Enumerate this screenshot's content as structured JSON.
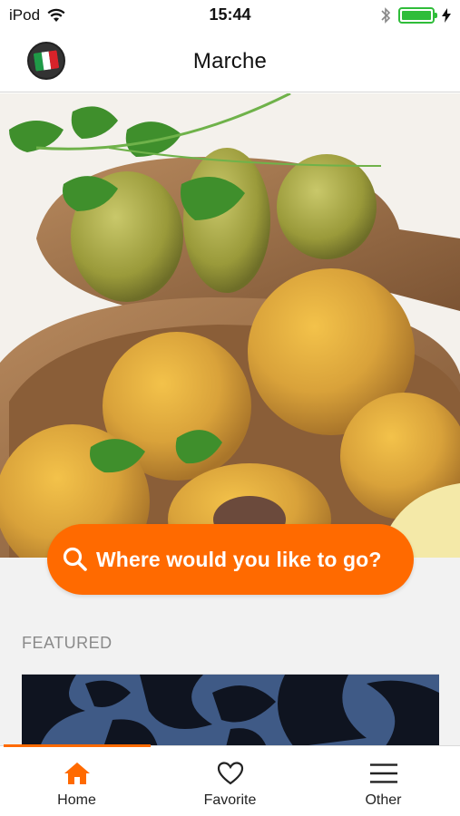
{
  "status_bar": {
    "carrier": "iPod",
    "time": "15:44",
    "battery_percent": 100,
    "battery_color": "#2fbd3a"
  },
  "nav": {
    "title": "Marche",
    "logo_icon": "region-flag-logo"
  },
  "search": {
    "placeholder": "Where would you like to go?",
    "icon": "search-icon",
    "color": "#ff6a00"
  },
  "featured": {
    "section_title": "FEATURED"
  },
  "tabs": [
    {
      "label": "Home",
      "icon": "home-icon",
      "active": true
    },
    {
      "label": "Favorite",
      "icon": "heart-icon",
      "active": false
    },
    {
      "label": "Other",
      "icon": "menu-icon",
      "active": false
    }
  ],
  "colors": {
    "accent": "#ff6a00",
    "background": "#f2f2f2"
  }
}
